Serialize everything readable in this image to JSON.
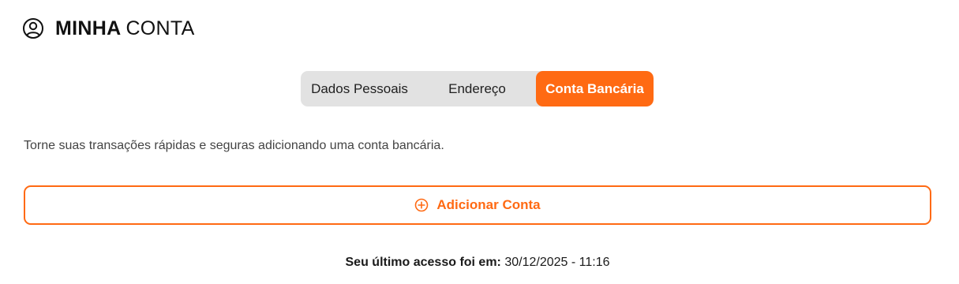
{
  "header": {
    "icon": "user-circle-icon",
    "title_strong": "MINHA",
    "title_light": "CONTA"
  },
  "tabs": [
    {
      "label": "Dados Pessoais",
      "active": false
    },
    {
      "label": "Endereço",
      "active": false
    },
    {
      "label": "Conta Bancária",
      "active": true
    }
  ],
  "content": {
    "description": "Torne suas transações rápidas e seguras adicionando uma conta bancária.",
    "add_button": {
      "icon": "plus-circle-icon",
      "label": "Adicionar Conta"
    }
  },
  "footer": {
    "last_access_label": "Seu último acesso foi em:",
    "last_access_value": "30/12/2025 - 11:16"
  },
  "colors": {
    "accent": "#ff6a13",
    "tabs_background": "#e2e2e2",
    "text": "#1a1a1a",
    "muted_text": "#444444"
  }
}
